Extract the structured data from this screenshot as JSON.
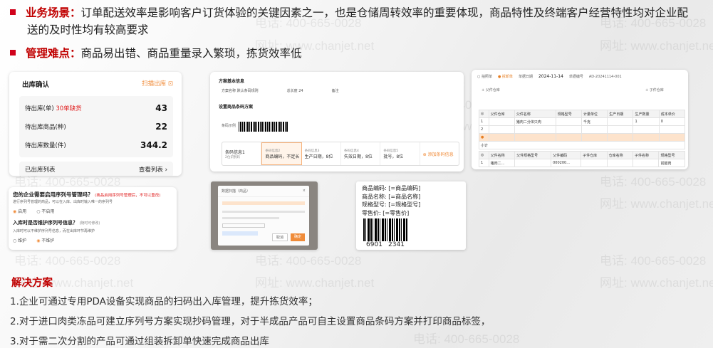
{
  "header": {
    "b1_keyword": "业务场景：",
    "b1_text_1": "订单配送效率是影响客户订货体验的关键因素之一，也是仓储周转效率的重要体现，商品特性及终端客户经营特性均对企业配",
    "b1_text_2": "送的及时性均有较高要求",
    "b2_keyword": "管理难点：",
    "b2_text": "商品易出错、商品重量录入繁琐，拣货效率低"
  },
  "colors": {
    "accent_red": "#c00000",
    "orange": "#f08c3a"
  },
  "card1": {
    "title": "出库确认",
    "scan_label": "扫描出库",
    "rows": [
      {
        "label": "待出库(单)",
        "extra": "30单缺货",
        "value": "43"
      },
      {
        "label": "待出库商品(种)",
        "extra": "",
        "value": "22"
      },
      {
        "label": "待出库数量(件)",
        "extra": "",
        "value": "344.2"
      }
    ],
    "footer_left": "已出库列表",
    "footer_right": "查看列表 ›"
  },
  "card2": {
    "section1": "方案基本信息",
    "scheme_label": "方案名称",
    "scheme_value": "默认条码规则",
    "total_label": "总长度",
    "total_value": "24",
    "note_label": "备注",
    "section2": "设置商品条码方案",
    "barcode_label": "条码示例",
    "tile_head_label": "条码信息1",
    "tile_head_value": "2位识别码",
    "tiles": [
      {
        "t1": "条码信息2",
        "t2": "商品编码，不定长"
      },
      {
        "t1": "条码信息3",
        "t2": "生产日期，8位"
      },
      {
        "t1": "条码信息4",
        "t2": "失效日期，8位"
      },
      {
        "t1": "条码信息5",
        "t2": "批号，8位"
      }
    ],
    "add_label": "添加条码信息"
  },
  "card3": {
    "tab1": "拍照单",
    "tab2": "拆卸单",
    "date_label": "单据日期",
    "date_value": "2024-11-14",
    "no_label": "单据编号",
    "no_value": "AD-20241114-001",
    "parent_wh": "父件仓库",
    "child_wh": "子件仓库",
    "table1_headers": [
      "父件仓库",
      "父件名称",
      "规格型号",
      "计量单位",
      "生产日期",
      "生产数量",
      "成本单价"
    ],
    "table1_rows": [
      [
        "1",
        "",
        "猪肉二分体只肉",
        "",
        "千克",
        "1",
        "0"
      ],
      [
        "2",
        "",
        "",
        "",
        "",
        "",
        ""
      ],
      [
        "3",
        "",
        "",
        "",
        "",
        "",
        ""
      ]
    ],
    "subtotal": "小计",
    "table2_headers": [
      "父件名称",
      "父件规格型号",
      "父件编码",
      "子件仓库",
      "仓库名称",
      "子件名称",
      "规格型号"
    ],
    "table2_rows": [
      [
        "1",
        "猪肉二...",
        "",
        "000200...",
        "",
        "",
        "前腿肉"
      ]
    ]
  },
  "card4": {
    "question": "您的企业需要启用序列号管理吗？",
    "tip": "(商品启用序列号管理后，不可以重改)",
    "desc": "进行序列号管理的商品，可以在入库、出库时输入唯一的序列号",
    "opt_yes": "启用",
    "opt_no": "不启用",
    "q2": "入库时是否维护序列号信息？",
    "q2_tip": "(随时可修改)",
    "q2_desc": "入库时可以不维护序列号信息，而在出库环节再维护",
    "opt2_yes": "维护",
    "opt2_no": "不维护"
  },
  "card5": {
    "title": "数据扫描（商品）",
    "ok": "确定",
    "cancel": "取消"
  },
  "card6": {
    "rows": [
      {
        "k": "商品编码:",
        "v": "[=商品编码]"
      },
      {
        "k": "商品名称:",
        "v": "[=商品名称]"
      },
      {
        "k": "规格型号:",
        "v": "[=规格型号]"
      },
      {
        "k": "零售价:",
        "v": "[=零售价]"
      }
    ],
    "barcode_num_1": "6901",
    "barcode_num_2": "2341"
  },
  "watermarks": {
    "phone": "电话: 400-665-0028",
    "site": "网址: www.chanjet.net"
  },
  "solution": {
    "title": "解决方案",
    "items": [
      "1.企业可通过专用PDA设备实现商品的扫码出入库管理，提升拣货效率；",
      "2.对于进口肉类冻品可建立序列号方案实现抄码管理，对于半成品产品可自主设置商品条码方案并打印商品标签，",
      "3.对于需二次分割的产品可通过组装拆卸单快速完成商品出库"
    ]
  }
}
